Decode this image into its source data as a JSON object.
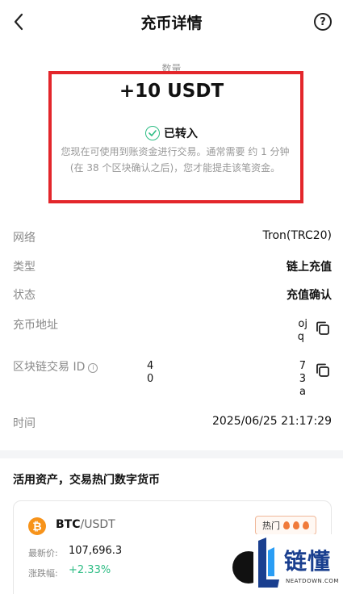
{
  "header": {
    "title": "充币详情",
    "help_glyph": "?"
  },
  "summary": {
    "amount_label": "数量",
    "amount": "+10 USDT",
    "status": "已转入",
    "description": "您现在可使用到账资金进行交易。通常需要 约 1 分钟 (在 38 个区块确认之后)，您才能提走该笔资金。"
  },
  "details": {
    "network": {
      "label": "网络",
      "value": "Tron(TRC20)"
    },
    "type": {
      "label": "类型",
      "value": "链上充值"
    },
    "state": {
      "label": "状态",
      "value": "充值确认"
    },
    "address": {
      "label": "充币地址",
      "fragment_line1": "oj",
      "fragment_line2": "q"
    },
    "txid": {
      "label": "区块链交易 ID",
      "fragment_line1": "4",
      "fragment_line2": "0",
      "tail_line1": "7",
      "tail_line2": "3",
      "tail_line3": "a"
    },
    "time": {
      "label": "时间",
      "value": "2025/06/25 21:17:29"
    }
  },
  "promo": {
    "section_title": "活用资产，交易热门数字货币",
    "card": {
      "base": "BTC",
      "quote": "/USDT",
      "hot_label": "热门",
      "price_label": "最新价:",
      "price": "107,696.3",
      "change_label": "涨跌幅:",
      "change": "+2.33%"
    }
  },
  "watermark": {
    "brand": "链懂",
    "domain": "NEATDOWN.COM"
  },
  "colors": {
    "highlight": "#e3262b",
    "positive": "#2ebd85",
    "btc": "#f7931a",
    "brand": "#1a3f8f"
  }
}
